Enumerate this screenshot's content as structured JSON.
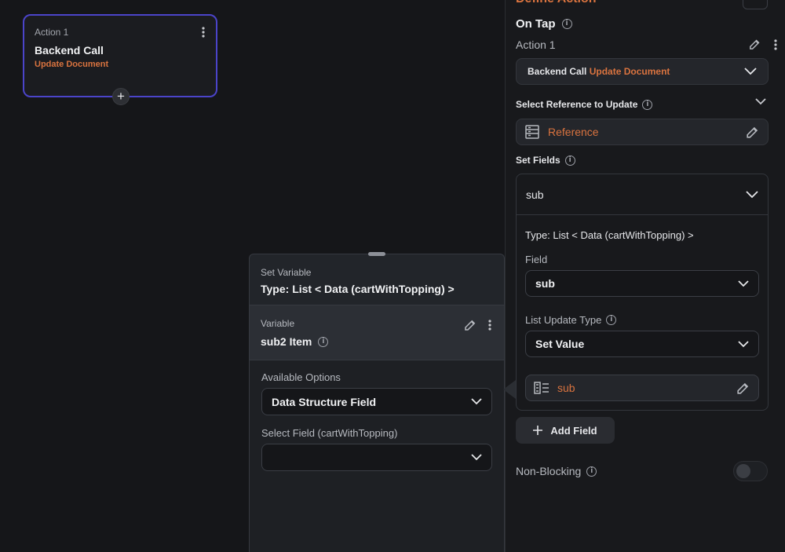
{
  "canvas": {
    "action_node": {
      "label": "Action 1",
      "title": "Backend Call",
      "subtitle": "Update Document"
    }
  },
  "set_variable": {
    "header_label": "Set Variable",
    "header_type": "Type: List < Data (cartWithTopping) >",
    "variable_label": "Variable",
    "variable_name": "sub2 Item",
    "available_options_label": "Available Options",
    "available_options_value": "Data Structure Field",
    "select_field_label": "Select Field (cartWithTopping)",
    "select_field_value": ""
  },
  "panel": {
    "title_cut": "Define Action",
    "on_tap": "On Tap",
    "action_label": "Action 1",
    "backend_call": "Backend Call",
    "backend_call_type": "Update Document",
    "select_reference_label": "Select Reference to Update",
    "reference_value": "Reference",
    "set_fields_label": "Set Fields",
    "field_name": "sub",
    "type_text": "Type: List < Data (cartWithTopping) >",
    "field_label": "Field",
    "field_value": "sub",
    "list_update_type_label": "List Update Type",
    "list_update_type_value": "Set Value",
    "value_source": "sub",
    "add_field_label": "Add Field",
    "non_blocking_label": "Non-Blocking"
  },
  "colors": {
    "accent": "#d9733f",
    "selected_border": "#4b44c9",
    "background": "#151619"
  }
}
